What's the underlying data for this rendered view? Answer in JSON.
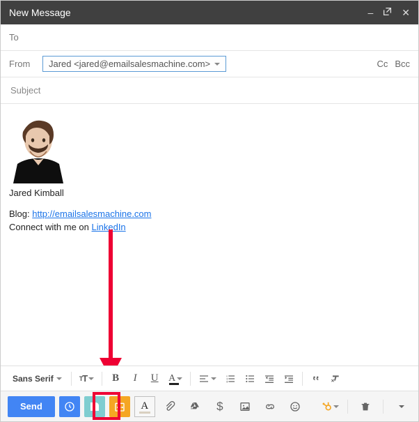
{
  "window": {
    "title": "New Message"
  },
  "fields": {
    "to_label": "To",
    "from_label": "From",
    "from_value": "Jared <jared@emailsalesmachine.com>",
    "cc_label": "Cc",
    "bcc_label": "Bcc",
    "subject_placeholder": "Subject"
  },
  "signature": {
    "name": "Jared Kimball",
    "blog_label": "Blog: ",
    "blog_url_text": "http://emailsalesmachine.com",
    "connect_prefix": "Connect with me on ",
    "connect_link_text": "LinkedIn"
  },
  "format": {
    "font_family": "Sans Serif"
  },
  "sendbar": {
    "send_label": "Send"
  }
}
